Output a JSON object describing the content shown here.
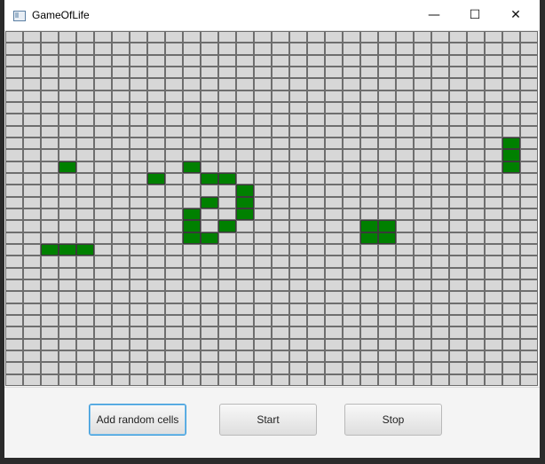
{
  "window": {
    "title": "GameOfLife",
    "minimize_glyph": "—",
    "maximize_glyph": "☐",
    "close_glyph": "✕",
    "icon": "app-window-icon"
  },
  "grid": {
    "columns": 30,
    "rows": 30,
    "alive_color": "#008000",
    "dead_color": "#d7d7d7",
    "alive_cells": [
      [
        11,
        3
      ],
      [
        12,
        8
      ],
      [
        11,
        10
      ],
      [
        12,
        11
      ],
      [
        12,
        12
      ],
      [
        13,
        13
      ],
      [
        14,
        11
      ],
      [
        14,
        13
      ],
      [
        15,
        10
      ],
      [
        15,
        13
      ],
      [
        16,
        10
      ],
      [
        16,
        12
      ],
      [
        17,
        10
      ],
      [
        17,
        11
      ],
      [
        18,
        2
      ],
      [
        18,
        3
      ],
      [
        18,
        4
      ],
      [
        16,
        20
      ],
      [
        16,
        21
      ],
      [
        17,
        20
      ],
      [
        17,
        21
      ],
      [
        9,
        28
      ],
      [
        10,
        28
      ],
      [
        11,
        28
      ]
    ]
  },
  "controls": {
    "add_random_label": "Add random cells",
    "start_label": "Start",
    "stop_label": "Stop"
  }
}
